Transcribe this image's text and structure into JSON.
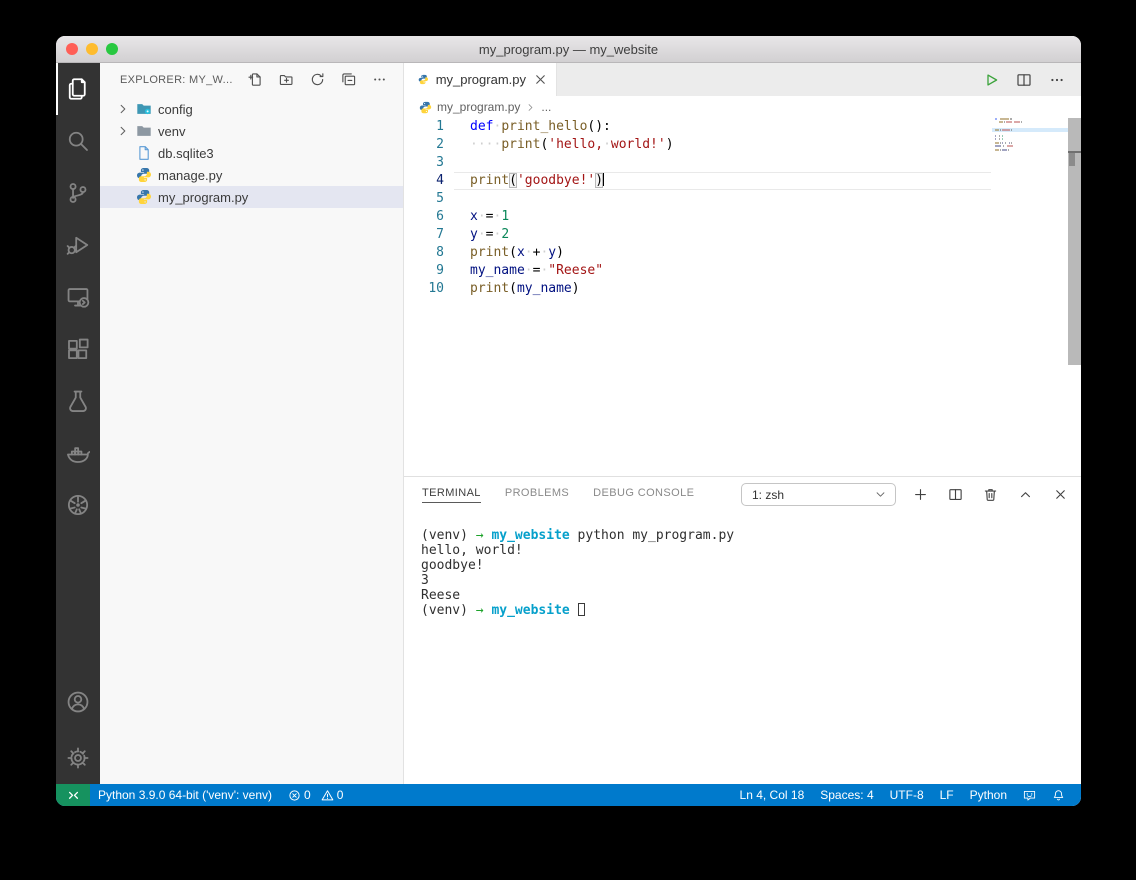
{
  "window": {
    "title": "my_program.py — my_website"
  },
  "activity_bar": {
    "top": [
      {
        "name": "explorer",
        "active": true
      },
      {
        "name": "search"
      },
      {
        "name": "source-control"
      },
      {
        "name": "run-debug"
      },
      {
        "name": "remote-explorer"
      },
      {
        "name": "extensions"
      },
      {
        "name": "testing"
      },
      {
        "name": "docker"
      },
      {
        "name": "kubernetes"
      }
    ],
    "bottom": [
      {
        "name": "accounts"
      },
      {
        "name": "settings"
      }
    ]
  },
  "sidebar": {
    "header": "EXPLORER: MY_W...",
    "actions": [
      {
        "name": "new-file"
      },
      {
        "name": "new-folder"
      },
      {
        "name": "refresh"
      },
      {
        "name": "collapse-all"
      },
      {
        "name": "more"
      }
    ],
    "files": [
      {
        "label": "config",
        "icon": "folder-config",
        "chevron": true
      },
      {
        "label": "venv",
        "icon": "folder",
        "chevron": true
      },
      {
        "label": "db.sqlite3",
        "icon": "file-db",
        "chevron": false
      },
      {
        "label": "manage.py",
        "icon": "py",
        "chevron": false
      },
      {
        "label": "my_program.py",
        "icon": "py",
        "chevron": false,
        "selected": true
      }
    ]
  },
  "editor": {
    "tab": {
      "label": "my_program.py",
      "icon": "py"
    },
    "actions": [
      {
        "name": "run-python-file",
        "icon": "run"
      },
      {
        "name": "split-editor",
        "icon": "split"
      },
      {
        "name": "more-actions",
        "icon": "ellipsis"
      }
    ],
    "breadcrumb": {
      "file": "my_program.py",
      "tail": "..."
    },
    "code": {
      "lines": [
        {
          "num": "1",
          "tokens": [
            [
              "kw",
              "def"
            ],
            [
              "ws",
              "·"
            ],
            [
              "fn",
              "print_hello"
            ],
            [
              "pl",
              "():"
            ]
          ]
        },
        {
          "num": "2",
          "tokens": [
            [
              "ws",
              "····"
            ],
            [
              "fn",
              "print"
            ],
            [
              "pl",
              "("
            ],
            [
              "str",
              "'hello,"
            ],
            [
              "ws",
              "·"
            ],
            [
              "str",
              "world!'"
            ],
            [
              "pl",
              ")"
            ]
          ]
        },
        {
          "num": "3",
          "tokens": []
        },
        {
          "num": "4",
          "current": true,
          "tokens": [
            [
              "fn",
              "print"
            ],
            [
              "br",
              "("
            ],
            [
              "str",
              "'goodbye!'"
            ],
            [
              "br",
              ")"
            ],
            [
              "cursor",
              ""
            ]
          ]
        },
        {
          "num": "5",
          "tokens": []
        },
        {
          "num": "6",
          "tokens": [
            [
              "var",
              "x"
            ],
            [
              "ws",
              "·"
            ],
            [
              "pl",
              "="
            ],
            [
              "ws",
              "·"
            ],
            [
              "num",
              "1"
            ]
          ]
        },
        {
          "num": "7",
          "tokens": [
            [
              "var",
              "y"
            ],
            [
              "ws",
              "·"
            ],
            [
              "pl",
              "="
            ],
            [
              "ws",
              "·"
            ],
            [
              "num",
              "2"
            ]
          ]
        },
        {
          "num": "8",
          "tokens": [
            [
              "fn",
              "print"
            ],
            [
              "pl",
              "("
            ],
            [
              "var",
              "x"
            ],
            [
              "ws",
              "·"
            ],
            [
              "pl",
              "+"
            ],
            [
              "ws",
              "·"
            ],
            [
              "var",
              "y"
            ],
            [
              "pl",
              ")"
            ]
          ]
        },
        {
          "num": "9",
          "tokens": [
            [
              "var",
              "my_name"
            ],
            [
              "ws",
              "·"
            ],
            [
              "pl",
              "="
            ],
            [
              "ws",
              "·"
            ],
            [
              "str",
              "\"Reese\""
            ]
          ]
        },
        {
          "num": "10",
          "tokens": [
            [
              "fn",
              "print"
            ],
            [
              "pl",
              "("
            ],
            [
              "var",
              "my_name"
            ],
            [
              "pl",
              ")"
            ]
          ]
        }
      ]
    }
  },
  "terminal": {
    "tabs": [
      {
        "label": "TERMINAL",
        "active": true
      },
      {
        "label": "PROBLEMS",
        "active": false
      },
      {
        "label": "DEBUG CONSOLE",
        "active": false
      }
    ],
    "dropdown": "1: zsh",
    "actions": [
      {
        "name": "new-terminal",
        "icon": "plus"
      },
      {
        "name": "split-terminal",
        "icon": "split"
      },
      {
        "name": "kill-terminal",
        "icon": "trash"
      },
      {
        "name": "maximize-panel",
        "icon": "chevron-up"
      },
      {
        "name": "close-panel",
        "icon": "close"
      }
    ],
    "lines": [
      {
        "tokens": [
          [
            "pl",
            "(venv) "
          ],
          [
            "gr",
            "→"
          ],
          [
            "pl",
            " "
          ],
          [
            "cy",
            "my_website"
          ],
          [
            "pl",
            " python my_program.py"
          ]
        ]
      },
      {
        "tokens": [
          [
            "pl",
            "hello, world!"
          ]
        ]
      },
      {
        "tokens": [
          [
            "pl",
            "goodbye!"
          ]
        ]
      },
      {
        "tokens": [
          [
            "pl",
            "3"
          ]
        ]
      },
      {
        "tokens": [
          [
            "pl",
            "Reese"
          ]
        ]
      },
      {
        "tokens": [
          [
            "pl",
            "(venv) "
          ],
          [
            "gr",
            "→"
          ],
          [
            "pl",
            " "
          ],
          [
            "cy",
            "my_website"
          ],
          [
            "pl",
            " "
          ],
          [
            "cursor",
            ""
          ]
        ]
      }
    ]
  },
  "status_bar": {
    "left": [
      {
        "name": "remote-indicator",
        "icon": "remote"
      },
      {
        "name": "python-interpreter",
        "text": "Python 3.9.0 64-bit ('venv': venv)"
      },
      {
        "name": "problems",
        "segments": [
          {
            "icon": "error",
            "text": "0"
          },
          {
            "icon": "warning",
            "text": "0"
          }
        ]
      }
    ],
    "right": [
      {
        "name": "cursor-position",
        "text": "Ln 4, Col 18"
      },
      {
        "name": "indentation",
        "text": "Spaces: 4"
      },
      {
        "name": "encoding",
        "text": "UTF-8"
      },
      {
        "name": "eol-sequence",
        "text": "LF"
      },
      {
        "name": "language-mode",
        "text": "Python"
      },
      {
        "name": "feedback",
        "icon": "feedback"
      },
      {
        "name": "notifications",
        "icon": "bell"
      }
    ]
  },
  "colors": {
    "statusbar-bg": "#007acc",
    "remote-bg": "#16925f",
    "activitybar-bg": "#333333",
    "titlebar-top": "#e8e6e8",
    "titlebar-bottom": "#d2d0d2",
    "sidebar-bg": "#f8f8f8",
    "tabbar-bg": "#ececec",
    "selection-bg": "#e4e6f1",
    "linenum": "#237893",
    "linenum-active": "#0b216f",
    "kw": "#0000ff",
    "fn": "#795e26",
    "str": "#a31515",
    "num": "#098658",
    "var": "#001080",
    "term-green": "#1ea32b",
    "term-cyan": "#06a0cb",
    "run-green": "#3ba33b",
    "mm-cur": "#d5eafb",
    "traffic-red": "#ff5f57",
    "traffic-yellow": "#febc2e",
    "traffic-green": "#28c840",
    "py-blue": "#3776ab",
    "py-yellow": "#ffd43b"
  }
}
